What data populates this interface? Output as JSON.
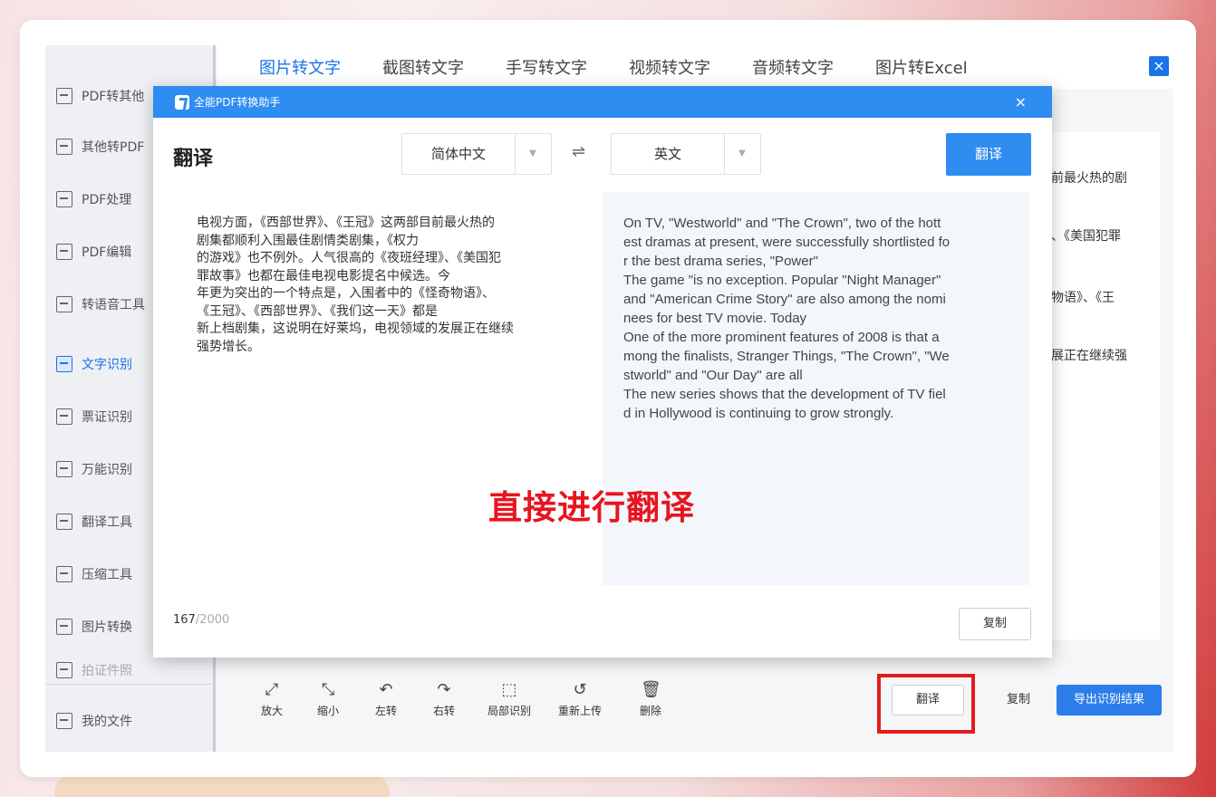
{
  "sidebar": {
    "items": [
      {
        "label": "PDF转其他",
        "icon": "pdf-convert-icon"
      },
      {
        "label": "其他转PDF",
        "icon": "to-pdf-icon"
      },
      {
        "label": "PDF处理",
        "icon": "pdf-process-icon"
      },
      {
        "label": "PDF编辑",
        "icon": "pdf-edit-icon"
      },
      {
        "label": "转语音工具",
        "icon": "voice-icon"
      },
      {
        "label": "文字识别",
        "icon": "ocr-icon"
      },
      {
        "label": "票证识别",
        "icon": "ticket-icon"
      },
      {
        "label": "万能识别",
        "icon": "universal-icon"
      },
      {
        "label": "翻译工具",
        "icon": "translate-icon"
      },
      {
        "label": "压缩工具",
        "icon": "compress-icon"
      },
      {
        "label": "图片转换",
        "icon": "image-convert-icon"
      },
      {
        "label": "拍证件照",
        "icon": "id-photo-icon"
      },
      {
        "label": "我的文件",
        "icon": "my-files-icon"
      }
    ]
  },
  "tabs": [
    "图片转文字",
    "截图转文字",
    "手写转文字",
    "视频转文字",
    "音频转文字",
    "图片转Excel"
  ],
  "right_panel_lines": [
    "前最火热的剧",
    "、《美国犯罪",
    "物语》、《王",
    "展正在继续强"
  ],
  "toolbar": {
    "tools": [
      {
        "label": "放大",
        "icon": "zoom-in-icon",
        "glyph": "⤢"
      },
      {
        "label": "缩小",
        "icon": "zoom-out-icon",
        "glyph": "⤡"
      },
      {
        "label": "左转",
        "icon": "rotate-left-icon",
        "glyph": "↶"
      },
      {
        "label": "右转",
        "icon": "rotate-right-icon",
        "glyph": "↷"
      },
      {
        "label": "局部识别",
        "icon": "partial-recognize-icon",
        "glyph": "⬚"
      },
      {
        "label": "重新上传",
        "icon": "reupload-icon",
        "glyph": "↺"
      },
      {
        "label": "删除",
        "icon": "delete-icon",
        "glyph": "🗑"
      }
    ],
    "translate_label": "翻译",
    "copy_label": "复制",
    "export_label": "导出识别结果"
  },
  "modal": {
    "app_name": "全能PDF转换助手",
    "close_glyph": "×",
    "title": "翻译",
    "source_lang": "简体中文",
    "target_lang": "英文",
    "swap_glyph": "⇌",
    "translate_button": "翻译",
    "source_text": "电视方面，《西部世界》、《王冠》这两部目前最火热的\n剧集都顺利入围最佳剧情类剧集，《权力\n的游戏》也不例外。人气很高的《夜班经理》、《美国犯\n罪故事》也都在最佳电视电影提名中候选。今\n年更为突出的一个特点是，入围者中的《怪奇物语》、\n《王冠》、《西部世界》、《我们这一天》都是\n新上档剧集，这说明在好莱坞，电视领域的发展正在继续\n强势增长。",
    "translated_text": "On TV, \"Westworld\" and \"The Crown\", two of the hott\nest dramas at present, were successfully shortlisted fo\nr the best drama series, \"Power\"\nThe game \"is no exception. Popular \"Night Manager\"\n and \"American Crime Story\" are also among the nomi\nnees for best TV movie. Today\nOne of the more prominent features of 2008 is that a\nmong the finalists, Stranger Things, \"The Crown\", \"We\nstworld\" and \"Our Day\" are all\nThe new series shows that the development of TV fiel\nd in Hollywood is continuing to grow strongly.",
    "overlay_caption": "直接进行翻译",
    "char_count": "167",
    "char_max": "/2000",
    "copy_button": "复制"
  },
  "colors": {
    "accent": "#2f8cf0",
    "highlight_box": "#e21c1c",
    "caption": "#e8141f"
  }
}
